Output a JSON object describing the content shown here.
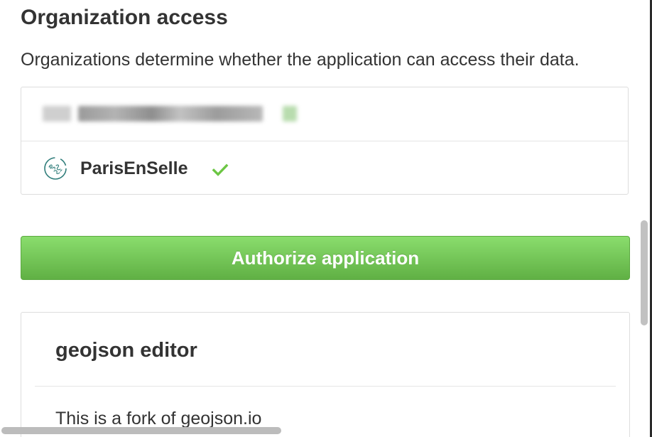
{
  "organization_access": {
    "title": "Organization access",
    "description": "Organizations determine whether the application can access their data."
  },
  "organizations": [
    {
      "name": "",
      "redacted": true,
      "status_icon": "checkmark-icon"
    },
    {
      "name": "ParisEnSelle",
      "logo_icon": "parisenselle-logo",
      "status_icon": "checkmark-icon",
      "status_color": "#6cc644"
    }
  ],
  "actions": {
    "authorize_label": "Authorize application",
    "authorize_color": "#60b044"
  },
  "app": {
    "name": "geojson editor",
    "description": "This is a fork of geojson.io"
  }
}
